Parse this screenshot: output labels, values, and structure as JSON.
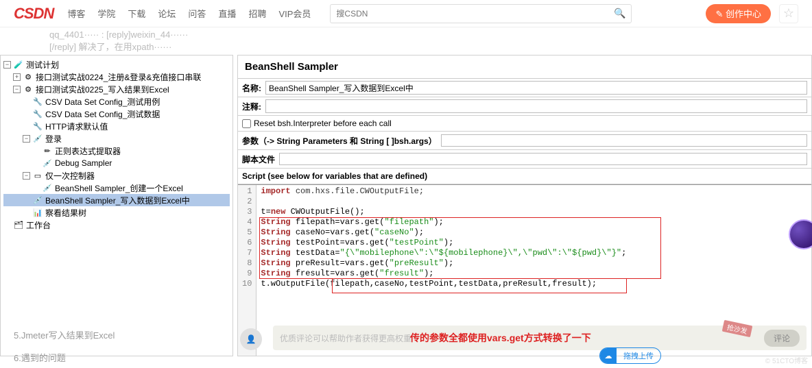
{
  "header": {
    "logo": "CSDN",
    "nav": [
      "博客",
      "学院",
      "下载",
      "论坛",
      "问答",
      "直播",
      "招聘",
      "VIP会员"
    ],
    "search_placeholder": "搜CSDN",
    "create_label": "✎ 创作中心"
  },
  "gray_strip": {
    "line1": "qq_4401····· : [reply]weixin_44······",
    "line2": "[/reply] 解决了，在用xpath······"
  },
  "tree": {
    "root": "测试计划",
    "n1": "接口测试实战0224_注册&登录&充值接口串联",
    "n2": "接口测试实战0225_写入结果到Excel",
    "csv1": "CSV Data Set Config_测试用例",
    "csv2": "CSV Data Set Config_测试数据",
    "http": "HTTP请求默认值",
    "login": "登录",
    "regex": "正则表达式提取器",
    "debug": "Debug Sampler",
    "once": "仅一次控制器",
    "bs1": "BeanShell Sampler_创建一个Excel",
    "bs2": "BeanShell Sampler_写入数据到Excel中",
    "viewtree": "察看结果树",
    "workbench": "工作台"
  },
  "panel": {
    "title": "BeanShell Sampler",
    "name_label": "名称:",
    "name_value": "BeanShell Sampler_写入数据到Excel中",
    "comment_label": "注释:",
    "reset_label": "Reset bsh.Interpreter before each call",
    "params_label": "参数（-> String Parameters 和 String [ ]bsh.args）",
    "scriptfile_label": "脚本文件",
    "script_header": "Script (see below for variables that are defined)"
  },
  "code": {
    "l1_a": "import",
    "l1_b": " com.hxs.file.CWOutputFile;",
    "l3_a": "t=",
    "l3_b": "new",
    "l3_c": " CWOutputFile();",
    "l4_a": "String",
    "l4_b": " filepath=vars.get(",
    "l4_c": "\"filepath\"",
    "l4_d": ");",
    "l5_a": "String",
    "l5_b": " caseNo=vars.get(",
    "l5_c": "\"caseNo\"",
    "l5_d": ");",
    "l6_a": "String",
    "l6_b": " testPoint=vars.get(",
    "l6_c": "\"testPoint\"",
    "l6_d": ");",
    "l7_a": "String",
    "l7_b": " testData=",
    "l7_c": "\"{\\\"mobilephone\\\":\\\"${mobilephone}\\\",\\\"pwd\\\":\\\"${pwd}\\\"}\"",
    "l7_d": ";",
    "l8_a": "String",
    "l8_b": " preResult=vars.get(",
    "l8_c": "\"preResult\"",
    "l8_d": ");",
    "l9_a": "String",
    "l9_b": " fresult=vars.get(",
    "l9_c": "\"fresult\"",
    "l9_d": ");",
    "l10": "t.wOutputFile(filepath,caseNo,testPoint,testData,preResult,fresult);"
  },
  "bottom": {
    "toc1": "5.Jmeter写入结果到Excel",
    "toc2": "6.遇到的问题",
    "comment_placeholder": "优质评论可以帮助作者获得更高权重",
    "annotation": "传的参数全都使用vars.get方式转换了一下",
    "sofa": "抢沙发",
    "reply": "评论",
    "upload": "拖拽上传",
    "watermark": "© 51CTO博客"
  }
}
